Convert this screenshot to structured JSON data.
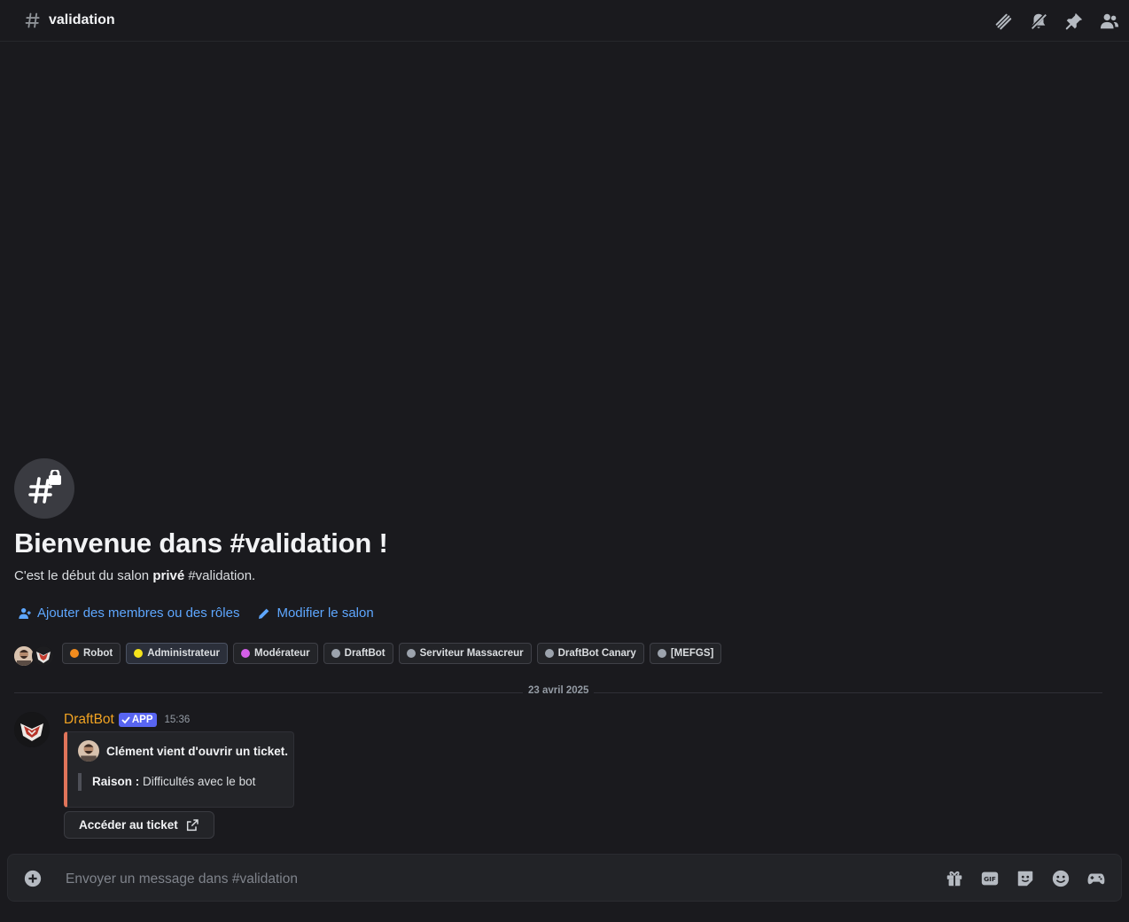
{
  "header": {
    "channel_name": "validation",
    "icons": [
      "threads-icon",
      "mute-notifications-icon",
      "pin-icon",
      "member-list-icon"
    ]
  },
  "welcome": {
    "icon": "private-channel-hash-lock-icon",
    "title": "Bienvenue dans #validation !",
    "subtitle_prefix": "C'est le début du salon ",
    "subtitle_bold": "privé",
    "subtitle_suffix": " #validation.",
    "actions": [
      {
        "label": "Ajouter des membres ou des rôles",
        "icon": "add-members-icon"
      },
      {
        "label": "Modifier le salon",
        "icon": "pencil-icon"
      }
    ]
  },
  "roles": [
    {
      "name": "Robot",
      "color": "#f28c1e"
    },
    {
      "name": "Administrateur",
      "color": "#f5e31b"
    },
    {
      "name": "Modérateur",
      "color": "#d45fe8"
    },
    {
      "name": "DraftBot",
      "color": "#9ca3ad"
    },
    {
      "name": "Serviteur Massacreur",
      "color": "#9ca3ad"
    },
    {
      "name": "DraftBot Canary",
      "color": "#9ca3ad"
    },
    {
      "name": "[MEFGS]",
      "color": "#9ca3ad"
    }
  ],
  "divider": {
    "date": "23 avril 2025"
  },
  "message": {
    "author": "DraftBot",
    "author_color": "#f1a322",
    "badge": "APP",
    "time": "15:36",
    "embed": {
      "author_text": "Clément vient d'ouvrir un ticket.",
      "reason_label": "Raison :",
      "reason_text": " Difficultés avec le bot",
      "accent_color": "#e0745a"
    },
    "button_label": "Accéder au ticket"
  },
  "composer": {
    "placeholder": "Envoyer un message dans #validation",
    "icons": [
      "gift-icon",
      "gif-icon",
      "sticker-icon",
      "emoji-icon",
      "activities-icon"
    ]
  }
}
